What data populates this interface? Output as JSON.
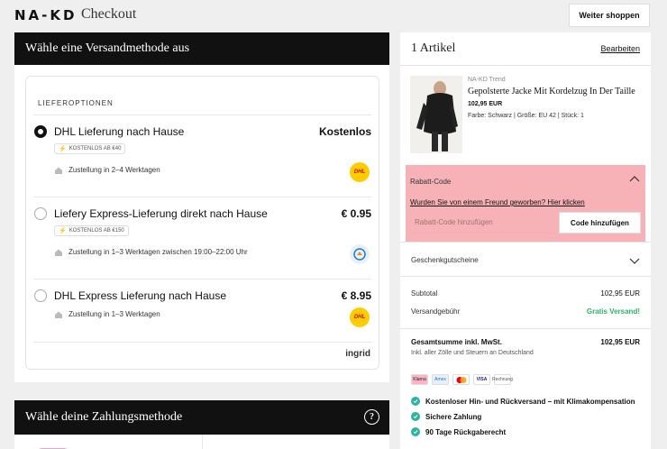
{
  "header": {
    "logo": "NA-KD",
    "title": "Checkout",
    "continue_label": "Weiter shoppen"
  },
  "delivery": {
    "heading": "Wähle eine Versandmethode aus",
    "section_label": "LIEFEROPTIONEN",
    "options": [
      {
        "title": "DHL Lieferung nach Hause",
        "price": "Kostenlos",
        "badge": "KOSTENLOS AB €40",
        "subtitle": "Zustellung in 2–4 Werktagen",
        "carrier": "dhl",
        "carrier_label": "DHL",
        "selected": true
      },
      {
        "title": "Liefery Express-Lieferung direkt nach Hause",
        "price": "€ 0.95",
        "badge": "KOSTENLOS AB €150",
        "subtitle": "Zustellung in 1–3 Werktagen zwischen 19:00–22:00 Uhr",
        "carrier": "liefery",
        "selected": false
      },
      {
        "title": "DHL Express Lieferung nach Hause",
        "price": "€ 8.95",
        "subtitle": "Zustellung in 1–3 Werktagen",
        "carrier": "dhl",
        "carrier_label": "DHL",
        "selected": false
      }
    ],
    "provider": "ingrid"
  },
  "payment": {
    "heading": "Wähle deine Zahlungsmethode",
    "help_icon": "question-circle-icon",
    "help_glyph": "?"
  },
  "cart": {
    "title": "1 Artikel",
    "edit_label": "Bearbeiten",
    "product": {
      "brand": "NA-KD Trend",
      "name": "Gepolsterte Jacke Mit Kordelzug In Der Taille",
      "price": "102,95 EUR",
      "attrs": "Farbe: Schwarz  |  Größe: EU 42  |  Stück: 1"
    },
    "discount": {
      "title": "Rabatt-Code",
      "link": "Wurden Sie von einem Freund geworben? Hier klicken",
      "placeholder": "Rabatt-Code hinzufügen",
      "button": "Code hinzufügen"
    },
    "gift_cards": "Geschenkgutscheine",
    "subtotal_label": "Subtotal",
    "subtotal_value": "102,95 EUR",
    "shipping_label": "Versandgebühr",
    "shipping_value": "Gratis Versand!",
    "total_label": "Gesamtsumme inkl. MwSt.",
    "total_value": "102,95 EUR",
    "tax_note": "Inkl. aller Zölle und Steuern an Deutschland",
    "payment_methods": [
      "Klarna",
      "Amex",
      "Mastercard",
      "VISA",
      "Rechnung"
    ],
    "usps": [
      "Kostenloser Hin- und Rückversand – mit Klimakompensation",
      "Sichere Zahlung",
      "90 Tage Rückgaberecht"
    ]
  },
  "colors": {
    "accent_green": "#2db36e",
    "discount_bg": "#f7b2b7",
    "dhl_yellow": "#ffcc00",
    "dark": "#111111"
  }
}
